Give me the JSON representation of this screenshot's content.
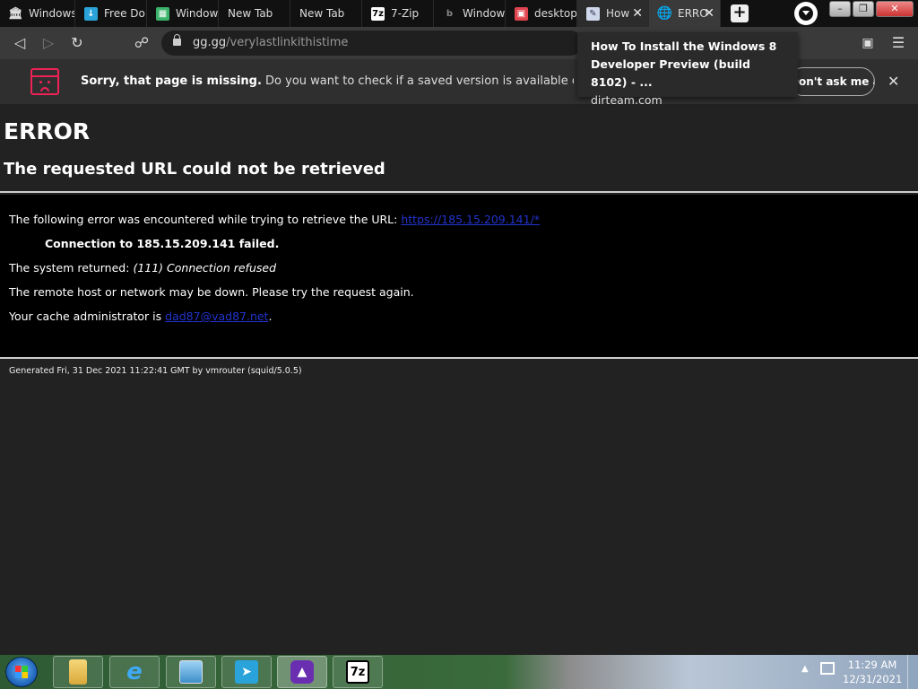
{
  "tabs": [
    {
      "label": "Windows",
      "icon": "columns-icon",
      "color": "#dddddd"
    },
    {
      "label": "Free Do",
      "icon": "free-download-icon",
      "color": "#29a3d9"
    },
    {
      "label": "Windows",
      "icon": "spreadsheet-icon",
      "color": "#3bb36b"
    },
    {
      "label": "New Tab",
      "icon": "",
      "color": ""
    },
    {
      "label": "New Tab",
      "icon": "",
      "color": ""
    },
    {
      "label": "7-Zip",
      "icon": "7zip-icon",
      "color": "#ffffff"
    },
    {
      "label": "Window",
      "icon": "bing-icon",
      "color": "#777777"
    },
    {
      "label": "desktop",
      "icon": "store-icon",
      "color": "#e0444f"
    },
    {
      "label": "How",
      "icon": "document-icon",
      "color": "#cfd8ea"
    },
    {
      "label": "ERRO",
      "icon": "globe-icon",
      "color": "#cccccc"
    }
  ],
  "url": {
    "domain": "gg.gg",
    "path": "/verylastlinkithistime"
  },
  "infobar": {
    "bold": "Sorry, that page is missing.",
    "text": "Do you want to check if a saved version is available on the Wayb…",
    "ask_button": "Don't ask me again"
  },
  "tooltip": {
    "title_line1": "How To Install the Windows 8",
    "title_line2": "Developer Preview (build 8102) - ...",
    "domain": "dirteam.com"
  },
  "page": {
    "h1": "ERROR",
    "h2": "The requested URL could not be retrieved",
    "line1_text": "The following error was encountered while trying to retrieve the URL:",
    "line1_link": "https://185.15.209.141/*",
    "line2": "Connection to 185.15.209.141 failed.",
    "line3_text": "The system returned:",
    "line3_italic": "(111) Connection refused",
    "line4": "The remote host or network may be down. Please try the request again.",
    "line5_text": "Your cache administrator is",
    "line5_link": "dad87@vad87.net",
    "line5_end": ".",
    "footer": "Generated Fri, 31 Dec 2021 11:22:41 GMT by vmrouter (squid/5.0.5)"
  },
  "taskbar": {
    "time": "11:29 AM",
    "date": "12/31/2021",
    "apps": [
      "folder-icon",
      "internet-explorer-icon",
      "photo-viewer-icon",
      "free-download-manager-icon",
      "brave-browser-icon",
      "7zip-icon"
    ]
  }
}
